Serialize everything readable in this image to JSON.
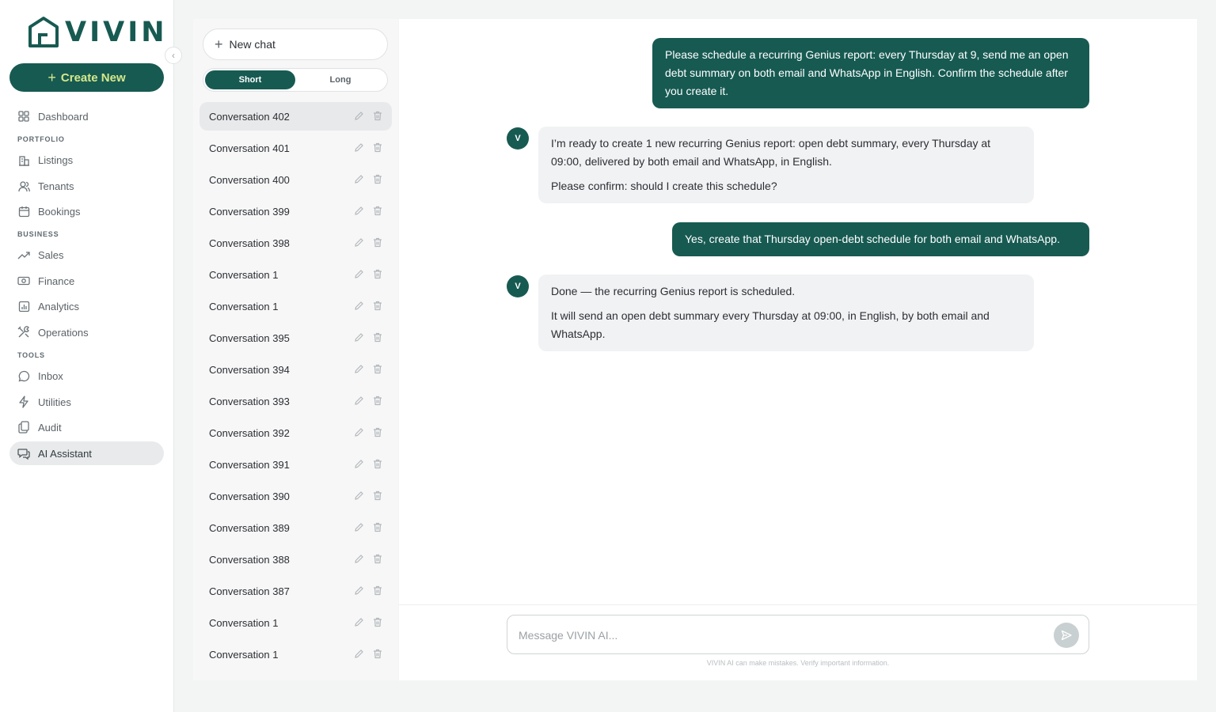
{
  "brand": {
    "name": "VIVIN",
    "color": "#175a52"
  },
  "sidebar": {
    "create_label": "Create New",
    "collapse_icon": "chevron-left-icon",
    "items": [
      {
        "label": "Dashboard",
        "icon": "grid-icon"
      },
      {
        "label": "Listings",
        "icon": "building-icon"
      },
      {
        "label": "Tenants",
        "icon": "users-icon"
      },
      {
        "label": "Bookings",
        "icon": "calendar-icon"
      },
      {
        "label": "Sales",
        "icon": "trending-up-icon"
      },
      {
        "label": "Finance",
        "icon": "banknote-icon"
      },
      {
        "label": "Analytics",
        "icon": "bar-chart-icon"
      },
      {
        "label": "Operations",
        "icon": "tools-icon"
      },
      {
        "label": "Inbox",
        "icon": "message-icon"
      },
      {
        "label": "Utilities",
        "icon": "lightning-icon"
      },
      {
        "label": "Audit",
        "icon": "clipboard-icon"
      },
      {
        "label": "AI Assistant",
        "icon": "chat-bubbles-icon",
        "active": true
      }
    ],
    "sections": {
      "portfolio": "PORTFOLIO",
      "business": "BUSINESS",
      "tools": "TOOLS"
    }
  },
  "conversations": {
    "new_chat_label": "New chat",
    "toggle": {
      "short": "Short",
      "long": "Long",
      "selected": "Short"
    },
    "items": [
      "Conversation 402",
      "Conversation 401",
      "Conversation 400",
      "Conversation 399",
      "Conversation 398",
      "Conversation 1",
      "Conversation 1",
      "Conversation 395",
      "Conversation 394",
      "Conversation 393",
      "Conversation 392",
      "Conversation 391",
      "Conversation 390",
      "Conversation 389",
      "Conversation 388",
      "Conversation 387",
      "Conversation 1",
      "Conversation 1"
    ],
    "active_index": 0
  },
  "chat": {
    "messages": [
      {
        "role": "user",
        "text": "Please schedule a recurring Genius report: every Thursday at 9, send me an open debt summary on both email and WhatsApp in English. Confirm the schedule after you create it."
      },
      {
        "role": "assistant",
        "avatar": "V",
        "paragraphs": [
          "I’m ready to create 1 new recurring Genius report: open debt summary, every Thursday at 09:00, delivered by both email and WhatsApp, in English.",
          "Please confirm: should I create this schedule?"
        ]
      },
      {
        "role": "user",
        "text": "Yes, create that Thursday open-debt schedule for both email and WhatsApp."
      },
      {
        "role": "assistant",
        "avatar": "V",
        "paragraphs": [
          "Done — the recurring Genius report is scheduled.",
          "It will send an open debt summary every Thursday at 09:00, in English, by both email and WhatsApp."
        ]
      }
    ],
    "composer": {
      "placeholder": "Message VIVIN AI...",
      "value": ""
    },
    "disclaimer": "VIVIN AI can make mistakes. Verify important information."
  }
}
